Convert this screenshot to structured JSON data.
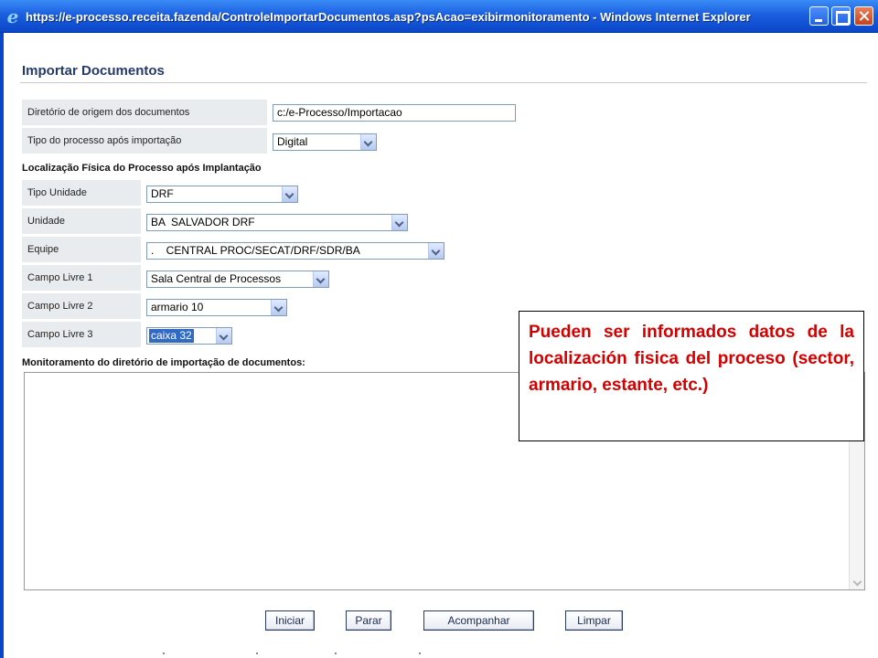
{
  "window": {
    "title": "https://e-processo.receita.fazenda/ControleImportarDocumentos.asp?psAcao=exibirmonitoramento - Windows Internet Explorer",
    "icon": "ie-icon"
  },
  "page": {
    "title": "Importar Documentos"
  },
  "origin": {
    "dir_label": "Diretório de origem dos documentos",
    "dir_value": "c:/e-Processo/Importacao",
    "type_label": "Tipo do processo após importação",
    "type_value": "Digital"
  },
  "location": {
    "section_title": "Localização Física do Processo após Implantação",
    "rows": [
      {
        "label": "Tipo Unidade",
        "value": "DRF"
      },
      {
        "label": "Unidade",
        "value": "BA  SALVADOR DRF"
      },
      {
        "label": "Equipe",
        "value": ".    CENTRAL PROC/SECAT/DRF/SDR/BA"
      },
      {
        "label": "Campo Livre 1",
        "value": "Sala Central de Processos"
      },
      {
        "label": "Campo Livre 2",
        "value": "armario 10"
      },
      {
        "label": "Campo Livre 3",
        "value": "caixa 32"
      }
    ]
  },
  "monitor": {
    "label": "Monitoramento do diretório de importação de documentos:",
    "content": ""
  },
  "buttons": {
    "start": "Iniciar",
    "stop": "Parar",
    "follow": "Acompanhar",
    "clear": "Limpar"
  },
  "annotation": {
    "text": "Pueden ser informados datos de la localización fisica del proceso (sector, armario, estante, etc.)",
    "color": "#d40000"
  },
  "colors": {
    "titlebar": "#1b5fe0",
    "label_bg": "#e9ecef",
    "selection": "#316ac5"
  }
}
